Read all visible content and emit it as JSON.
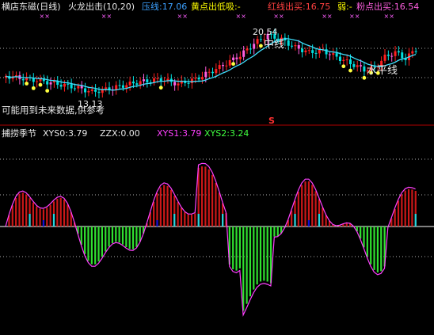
{
  "upper_panel": {
    "header": [
      {
        "text": "横店东磁(日线)",
        "color": "#e8e8e8"
      },
      {
        "text": "火龙出击(10,20)",
        "color": "#e8e8e8"
      },
      {
        "text": "压线:17.06",
        "color": "#3ca0ff"
      },
      {
        "text": "黄点出低吸:-",
        "color": "#ffff00"
      },
      {
        "text": "红线出买:16.75",
        "color": "#ff4040"
      },
      {
        "text": "弱:-",
        "color": "#ffff00"
      },
      {
        "text": "粉点出买:16.54",
        "color": "#ff5fe0"
      }
    ],
    "annotations": {
      "high_price": "20.54",
      "low_price": "13.13",
      "mid_line": "中线",
      "horizontal_line": "水平线",
      "disclaimer": "可能用到未来数据,供参考",
      "s_marker": "S"
    }
  },
  "lower_panel": {
    "header": [
      {
        "text": "捕捞季节",
        "color": "#e8e8e8"
      },
      {
        "text": "XYS0:3.79",
        "color": "#e8e8e8"
      },
      {
        "text": "ZZX:0.00",
        "color": "#e8e8e8"
      },
      {
        "text": "XYS1:3.79",
        "color": "#ff40ff"
      },
      {
        "text": "XYS2:3.24",
        "color": "#40ff40"
      }
    ]
  },
  "colors": {
    "background": "#000000",
    "up_candle": "#ff2020",
    "down_candle": "#00e0e0",
    "pink_candle": "#ff5fe0",
    "dotted_line": "#b0b0b0",
    "bar_up": "#cc1818",
    "bar_down": "#30e030",
    "bar_cyan": "#20d8e0",
    "bar_blue": "#1010d8",
    "mid_line": "#40e0ff"
  }
}
